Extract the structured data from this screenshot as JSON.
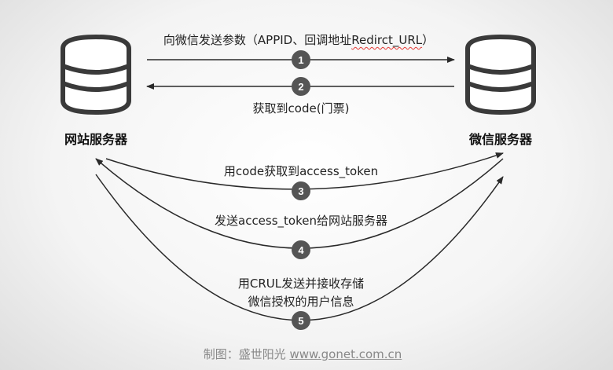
{
  "left_server": {
    "label": "网站服务器",
    "icon": "database-icon"
  },
  "right_server": {
    "label": "微信服务器",
    "icon": "database-icon"
  },
  "steps": [
    {
      "num": "1",
      "text_prefix": "向微信发送参数（APPID、回调地址",
      "text_squiggle": "Redirct_URL",
      "text_suffix": "）"
    },
    {
      "num": "2",
      "text": "获取到code(门票)"
    },
    {
      "num": "3",
      "text": "用code获取到access_token"
    },
    {
      "num": "4",
      "text": "发送access_token给网站服务器"
    },
    {
      "num": "5",
      "text_line1": "用CRUL发送并接收存储",
      "text_line2": "微信授权的用户信息"
    }
  ],
  "footer": {
    "prefix": "制图：盛世阳光 ",
    "url": "www.gonet.com.cn"
  },
  "colors": {
    "badge": "#555555",
    "arrow": "#2a2a2a"
  }
}
